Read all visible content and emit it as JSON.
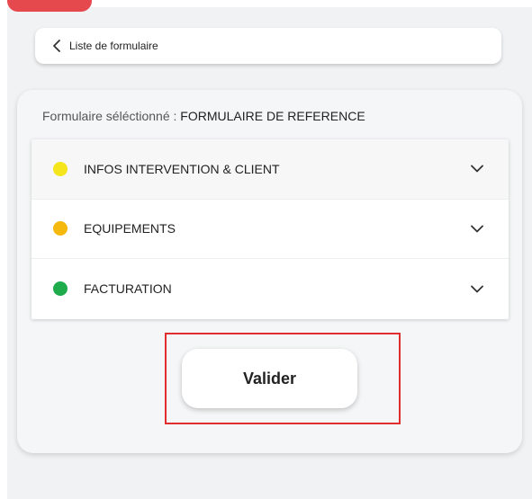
{
  "back": {
    "label": "Liste de formulaire",
    "icon": "chevron-left-icon"
  },
  "form": {
    "title_prefix": "Formulaire séléctionné : ",
    "title_value": "FORMULAIRE DE REFERENCE"
  },
  "sections": [
    {
      "label": "INFOS INTERVENTION & CLIENT",
      "status_color": "#f4e51c",
      "icon": "chevron-down-icon"
    },
    {
      "label": "EQUIPEMENTS",
      "status_color": "#f5b90d",
      "icon": "chevron-down-icon"
    },
    {
      "label": "FACTURATION",
      "status_color": "#1eab4c",
      "icon": "chevron-down-icon"
    }
  ],
  "actions": {
    "validate_label": "Valider"
  },
  "colors": {
    "accent_red": "#e5484d",
    "highlight_red": "#e02d2d"
  }
}
